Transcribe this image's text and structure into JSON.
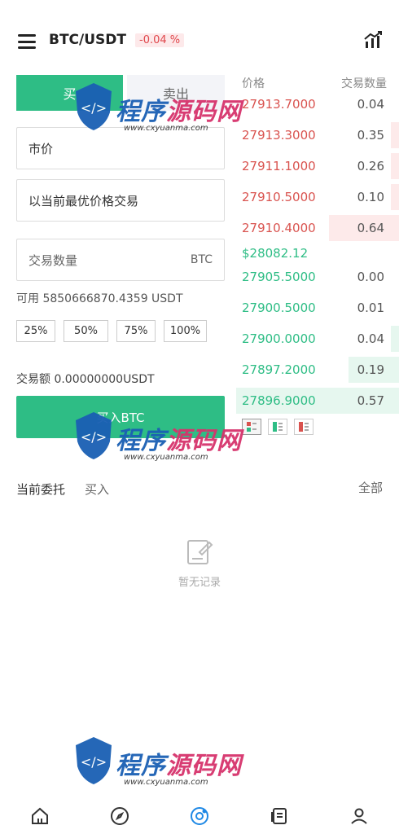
{
  "header": {
    "pair": "BTC/USDT",
    "change": "-0.04 %"
  },
  "form": {
    "tab_buy": "买",
    "tab_sell": "卖出",
    "order_type": "市价",
    "price_info": "以当前最优价格交易",
    "qty_placeholder": "交易数量",
    "qty_unit": "BTC",
    "available": "可用 5850666870.4359 USDT",
    "percents": [
      "25%",
      "50%",
      "75%",
      "100%"
    ],
    "amount": "交易额 0.00000000USDT",
    "buy_button": "买入BTC"
  },
  "orderbook": {
    "price_header": "价格",
    "qty_header": "交易数量",
    "asks": [
      {
        "price": "27913.7000",
        "qty": "0.04"
      },
      {
        "price": "27913.3000",
        "qty": "0.35"
      },
      {
        "price": "27911.1000",
        "qty": "0.26"
      },
      {
        "price": "27910.5000",
        "qty": "0.10"
      },
      {
        "price": "27910.4000",
        "qty": "0.64"
      }
    ],
    "last_price": "$28082.12",
    "bids": [
      {
        "price": "27905.5000",
        "qty": "0.00"
      },
      {
        "price": "27900.5000",
        "qty": "0.01"
      },
      {
        "price": "27900.0000",
        "qty": "0.04"
      },
      {
        "price": "27897.2000",
        "qty": "0.19"
      },
      {
        "price": "27896.9000",
        "qty": "0.57"
      }
    ]
  },
  "orders": {
    "title": "当前委托",
    "filter": "买入",
    "all": "全部",
    "empty": "暂无记录"
  },
  "watermark": {
    "brand_a": "程序",
    "brand_b": "源码网",
    "url": "www.cxyuanma.com"
  },
  "colors": {
    "buy": "#2ebd85",
    "sell": "#d9534f"
  }
}
